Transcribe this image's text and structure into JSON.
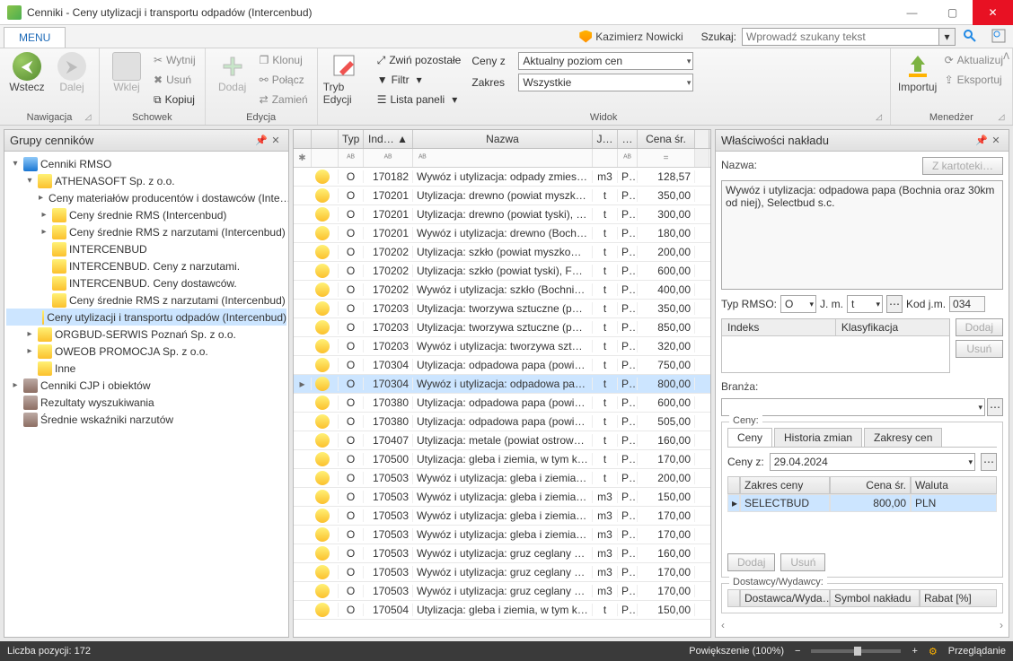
{
  "window": {
    "title": "Cenniki - Ceny utylizacji i transportu odpadów (Intercenbud)"
  },
  "menu": {
    "tab": "MENU"
  },
  "user": {
    "name": "Kazimierz Nowicki"
  },
  "search": {
    "label": "Szukaj:",
    "placeholder": "Wprowadź szukany tekst"
  },
  "ribbon": {
    "nav": {
      "label": "Nawigacja",
      "back": "Wstecz",
      "forward": "Dalej"
    },
    "clip": {
      "label": "Schowek",
      "paste": "Wklej",
      "cut": "Wytnij",
      "del": "Usuń",
      "copy": "Kopiuj"
    },
    "edit": {
      "label": "Edycja",
      "add": "Dodaj",
      "clone": "Klonuj",
      "link": "Połącz",
      "swap": "Zamień"
    },
    "view": {
      "label": "Widok",
      "editmode": "Tryb Edycji",
      "collapse": "Zwiń pozostałe",
      "filter": "Filtr",
      "panels": "Lista paneli",
      "ceny_z": "Ceny z",
      "ceny_z_val": "Aktualny poziom cen",
      "zakres": "Zakres",
      "zakres_val": "Wszystkie"
    },
    "mgr": {
      "label": "Menedżer",
      "import": "Importuj",
      "update": "Aktualizuj",
      "export": "Eksportuj"
    }
  },
  "tree": {
    "title": "Grupy cenników",
    "items": [
      {
        "depth": 0,
        "exp": "▾",
        "ico": "db",
        "label": "Cenniki RMSO"
      },
      {
        "depth": 1,
        "exp": "▾",
        "ico": "zl",
        "label": "ATHENASOFT Sp. z o.o."
      },
      {
        "depth": 2,
        "exp": "▸",
        "ico": "zl",
        "label": "Ceny materiałów producentów i dostawców (Inte…"
      },
      {
        "depth": 2,
        "exp": "▸",
        "ico": "zl",
        "label": "Ceny średnie RMS (Intercenbud)"
      },
      {
        "depth": 2,
        "exp": "▸",
        "ico": "zl",
        "label": "Ceny średnie RMS z narzutami (Intercenbud)"
      },
      {
        "depth": 2,
        "exp": "",
        "ico": "zl",
        "label": "INTERCENBUD"
      },
      {
        "depth": 2,
        "exp": "",
        "ico": "zl",
        "label": "INTERCENBUD. Ceny z narzutami."
      },
      {
        "depth": 2,
        "exp": "",
        "ico": "zl",
        "label": "INTERCENBUD. Ceny dostawców."
      },
      {
        "depth": 2,
        "exp": "",
        "ico": "zl",
        "label": "Ceny średnie RMS z narzutami (Intercenbud)"
      },
      {
        "depth": 2,
        "exp": "",
        "ico": "zl",
        "label": "Ceny utylizacji i transportu odpadów (Intercenbud)",
        "selected": true
      },
      {
        "depth": 1,
        "exp": "▸",
        "ico": "zl",
        "label": "ORGBUD-SERWIS Poznań Sp. z o.o."
      },
      {
        "depth": 1,
        "exp": "▸",
        "ico": "zl",
        "label": "OWEOB PROMOCJA Sp. z o.o."
      },
      {
        "depth": 1,
        "exp": "",
        "ico": "zl",
        "label": "Inne"
      },
      {
        "depth": 0,
        "exp": "▸",
        "ico": "other",
        "label": "Cenniki CJP i obiektów"
      },
      {
        "depth": 0,
        "exp": "",
        "ico": "other",
        "label": "Rezultaty wyszukiwania"
      },
      {
        "depth": 0,
        "exp": "",
        "ico": "other",
        "label": "Średnie wskaźniki narzutów"
      }
    ]
  },
  "grid": {
    "cols": {
      "typ": "Typ",
      "ind": "Ind…",
      "nazwa": "Nazwa",
      "jm": "J…",
      "p": "…",
      "cena": "Cena śr."
    },
    "rows": [
      {
        "typ": "O",
        "idx": "170182",
        "naz": "Wywóz i utylizacja: odpady zmieszane…",
        "jm": "m3",
        "p": "P…",
        "cena": "128,57"
      },
      {
        "typ": "O",
        "idx": "170201",
        "naz": "Utylizacja: drewno (powiat myszkowski)…",
        "jm": "t",
        "p": "P…",
        "cena": "350,00"
      },
      {
        "typ": "O",
        "idx": "170201",
        "naz": "Utylizacja: drewno (powiat tyski), Forest",
        "jm": "t",
        "p": "P…",
        "cena": "300,00"
      },
      {
        "typ": "O",
        "idx": "170201",
        "naz": "Wywóz i utylizacja: drewno (Bochnia or…",
        "jm": "t",
        "p": "P…",
        "cena": "180,00"
      },
      {
        "typ": "O",
        "idx": "170202",
        "naz": "Utylizacja: szkło (powiat myszkowski),…",
        "jm": "t",
        "p": "P…",
        "cena": "200,00"
      },
      {
        "typ": "O",
        "idx": "170202",
        "naz": "Utylizacja: szkło (powiat tyski), Forest",
        "jm": "t",
        "p": "P…",
        "cena": "600,00"
      },
      {
        "typ": "O",
        "idx": "170202",
        "naz": "Wywóz i utylizacja: szkło (Bochnia oraz…",
        "jm": "t",
        "p": "P…",
        "cena": "400,00"
      },
      {
        "typ": "O",
        "idx": "170203",
        "naz": "Utylizacja: tworzywa sztuczne (powiat…",
        "jm": "t",
        "p": "P…",
        "cena": "350,00"
      },
      {
        "typ": "O",
        "idx": "170203",
        "naz": "Utylizacja: tworzywa sztuczne (powiat t…",
        "jm": "t",
        "p": "P…",
        "cena": "850,00"
      },
      {
        "typ": "O",
        "idx": "170203",
        "naz": "Wywóz i utylizacja: tworzywa sztuczne…",
        "jm": "t",
        "p": "P…",
        "cena": "320,00"
      },
      {
        "typ": "O",
        "idx": "170304",
        "naz": "Utylizacja: odpadowa papa (powiat tys…",
        "jm": "t",
        "p": "P…",
        "cena": "750,00"
      },
      {
        "typ": "O",
        "idx": "170304",
        "naz": "Wywóz i utylizacja: odpadowa papa (Bo…",
        "jm": "t",
        "p": "P…",
        "cena": "800,00",
        "selected": true
      },
      {
        "typ": "O",
        "idx": "170380",
        "naz": "Utylizacja: odpadowa papa (powiat my…",
        "jm": "t",
        "p": "P…",
        "cena": "600,00"
      },
      {
        "typ": "O",
        "idx": "170380",
        "naz": "Utylizacja: odpadowa papa (powiat sied…",
        "jm": "t",
        "p": "P…",
        "cena": "505,00"
      },
      {
        "typ": "O",
        "idx": "170407",
        "naz": "Utylizacja: metale (powiat ostrowski), Z…",
        "jm": "t",
        "p": "P…",
        "cena": "160,00"
      },
      {
        "typ": "O",
        "idx": "170500",
        "naz": "Utylizacja: gleba i ziemia, w tym kamieni…",
        "jm": "t",
        "p": "P…",
        "cena": "170,00"
      },
      {
        "typ": "O",
        "idx": "170503",
        "naz": "Wywóz i utylizacja: gleba i ziemia, w ty…",
        "jm": "t",
        "p": "P…",
        "cena": "200,00"
      },
      {
        "typ": "O",
        "idx": "170503",
        "naz": "Wywóz i utylizacja: gleba i ziemia, w ty…",
        "jm": "m3",
        "p": "P…",
        "cena": "150,00"
      },
      {
        "typ": "O",
        "idx": "170503",
        "naz": "Wywóz i utylizacja: gleba i ziemia, w ty…",
        "jm": "m3",
        "p": "P…",
        "cena": "170,00"
      },
      {
        "typ": "O",
        "idx": "170503",
        "naz": "Wywóz i utylizacja: gleba i ziemia, w ty…",
        "jm": "m3",
        "p": "P…",
        "cena": "170,00"
      },
      {
        "typ": "O",
        "idx": "170503",
        "naz": "Wywóz i utylizacja: gruz ceglany (Ciesz…",
        "jm": "m3",
        "p": "P…",
        "cena": "160,00"
      },
      {
        "typ": "O",
        "idx": "170503",
        "naz": "Wywóz i utylizacja: gruz ceglany (Wisła…",
        "jm": "m3",
        "p": "P…",
        "cena": "170,00"
      },
      {
        "typ": "O",
        "idx": "170503",
        "naz": "Wywóz i utylizacja: gruz ceglany (Żory,…",
        "jm": "m3",
        "p": "P…",
        "cena": "170,00"
      },
      {
        "typ": "O",
        "idx": "170504",
        "naz": "Utylizacja: gleba i ziemia, w tym kamieni…",
        "jm": "t",
        "p": "P…",
        "cena": "150,00"
      }
    ]
  },
  "props": {
    "title": "Właściwości nakładu",
    "nazwa_lbl": "Nazwa:",
    "kartoteka_btn": "Z kartoteki…",
    "nazwa_val": "Wywóz i utylizacja: odpadowa papa (Bochnia oraz 30km od niej), Selectbud s.c.",
    "typ_lbl": "Typ RMSO:",
    "typ_val": "O",
    "jm_lbl": "J. m.",
    "jm_val": "t",
    "kod_lbl": "Kod j.m.",
    "kod_val": "034",
    "indeks_hdr": "Indeks",
    "klas_hdr": "Klasyfikacja",
    "dodaj": "Dodaj",
    "usun": "Usuń",
    "branza_lbl": "Branża:",
    "ceny_group": "Ceny:",
    "tab_ceny": "Ceny",
    "tab_hist": "Historia zmian",
    "tab_zakr": "Zakresy cen",
    "cenyz_lbl": "Ceny z:",
    "cenyz_val": "29.04.2024",
    "mg_zakres": "Zakres ceny",
    "mg_cena": "Cena śr.",
    "mg_waluta": "Waluta",
    "mg_row": {
      "zakres": "SELECTBUD",
      "cena": "800,00",
      "waluta": "PLN"
    },
    "dost_group": "Dostawcy/Wydawcy:",
    "dg_dost": "Dostawca/Wyda…",
    "dg_sym": "Symbol nakładu",
    "dg_rabat": "Rabat [%]"
  },
  "status": {
    "count_lbl": "Liczba pozycji: 172",
    "zoom": "Powiększenie (100%)",
    "mode": "Przeglądanie"
  }
}
